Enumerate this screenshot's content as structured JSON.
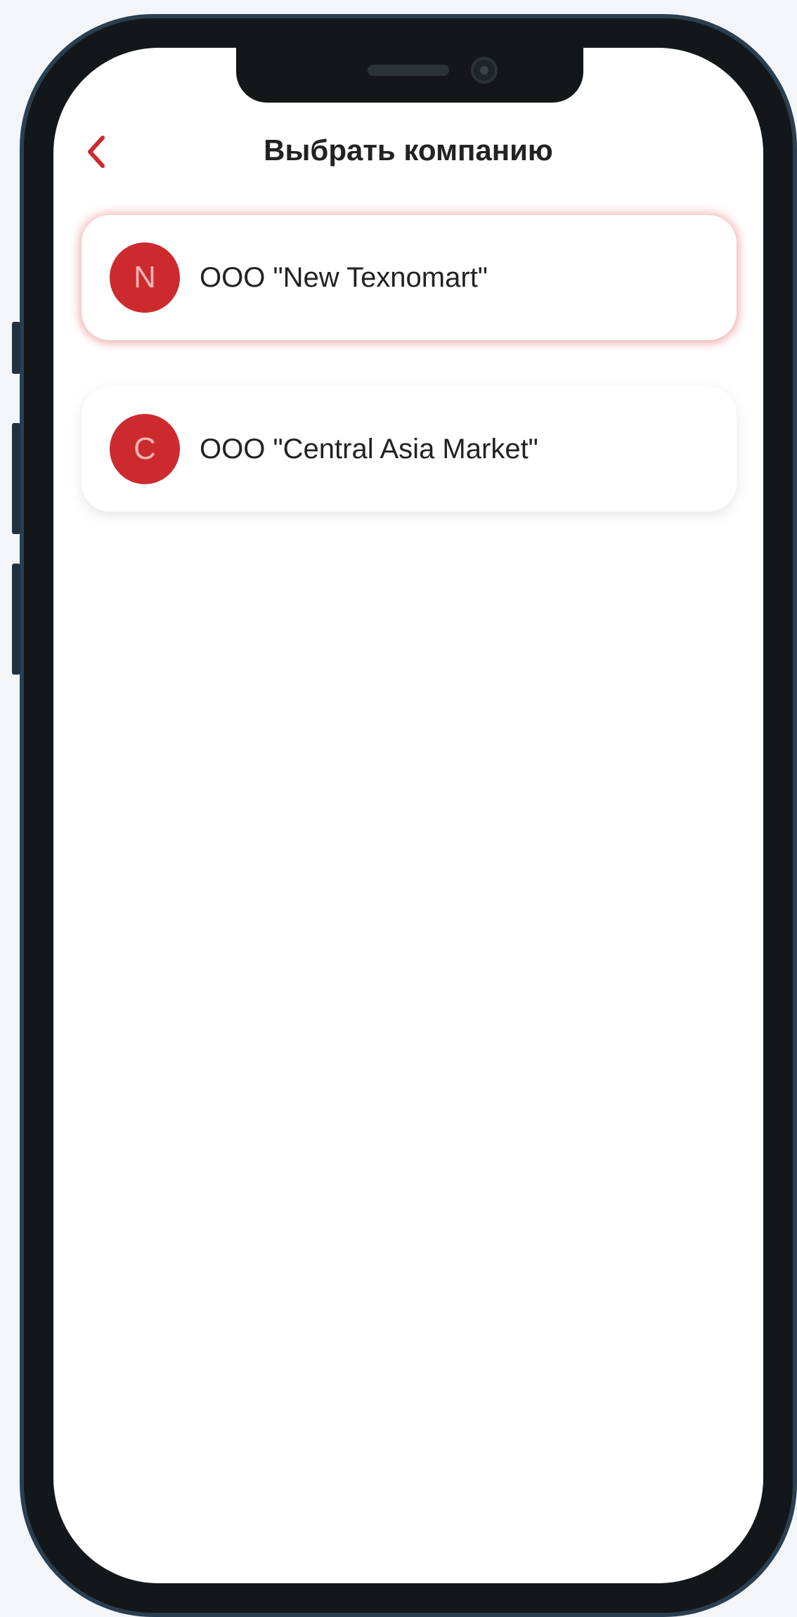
{
  "header": {
    "title": "Выбрать компанию",
    "back_icon": "chevron-left-icon"
  },
  "companies": [
    {
      "initial": "N",
      "name": "ООО \"New Texnomart\"",
      "selected": true
    },
    {
      "initial": "C",
      "name": "ООО \"Central Asia Market\"",
      "selected": false
    }
  ],
  "colors": {
    "accent": "#cc2a2e",
    "avatar_text": "#f0b5b3",
    "text": "#222222"
  }
}
